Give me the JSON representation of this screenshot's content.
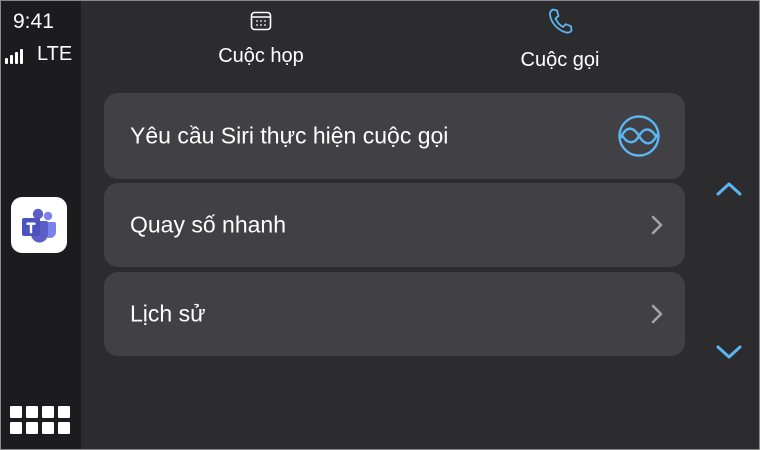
{
  "status": {
    "time": "9:41",
    "network": "LTE",
    "signal_bars": 4
  },
  "tabs": [
    {
      "label": "Cuộc họp",
      "icon": "calendar-icon",
      "selected": false
    },
    {
      "label": "Cuộc gọi",
      "icon": "phone-icon",
      "selected": true
    }
  ],
  "items": [
    {
      "label": "Yêu cầu Siri thực hiện cuộc gọi",
      "trailing_icon": "siri-icon"
    },
    {
      "label": "Quay số nhanh",
      "trailing_icon": "chevron-right-icon"
    },
    {
      "label": "Lịch sử",
      "trailing_icon": "chevron-right-icon"
    }
  ],
  "sidebar": {
    "app_icon": "teams-app-icon",
    "home_icon": "app-grid-icon"
  },
  "scroll": {
    "up_icon": "chevron-up-icon",
    "down_icon": "chevron-down-icon"
  },
  "colors": {
    "background": "#2c2c2e",
    "sidebar": "#1c1c1e",
    "row": "#414145",
    "accent": "#5ab6f2",
    "teams": "#5b5fc7",
    "chevron": "#a3a3a8"
  }
}
